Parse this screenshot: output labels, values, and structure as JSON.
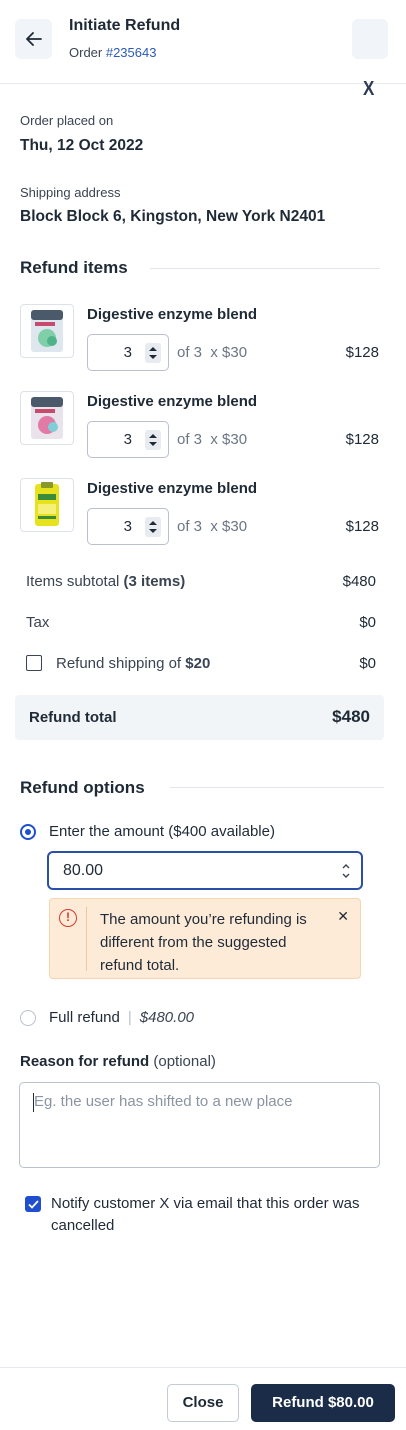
{
  "header": {
    "title": "Initiate Refund",
    "order_prefix": "Order ",
    "order_number": "#235643",
    "close_mark": "X"
  },
  "order": {
    "placed_label": "Order placed on",
    "placed_value": "Thu, 12 Oct 2022",
    "address_label": "Shipping address",
    "address_value": "Block Block 6, Kingston, New York N2401"
  },
  "refund_items": {
    "title": "Refund items",
    "items": [
      {
        "name": "Digestive enzyme blend",
        "qty": "3",
        "of_text": "of 3  x $30",
        "price": "$128",
        "thumb_icon": "pack-pink-green-icon"
      },
      {
        "name": "Digestive enzyme blend",
        "qty": "3",
        "of_text": "of 3  x $30",
        "price": "$128",
        "thumb_icon": "pack-pink-icon"
      },
      {
        "name": "Digestive enzyme blend",
        "qty": "3",
        "of_text": "of 3  x $30",
        "price": "$128",
        "thumb_icon": "pack-yellow-icon"
      }
    ]
  },
  "summary": {
    "subtotal_label": "Items subtotal ",
    "subtotal_count": "(3 items)",
    "subtotal_amount": "$480",
    "tax_label": "Tax",
    "tax_amount": "$0",
    "shipping_label": "Refund shipping of ",
    "shipping_value": "$20",
    "shipping_amount": "$0",
    "shipping_checked": false,
    "total_label": "Refund total",
    "total_amount": "$480"
  },
  "refund_options": {
    "title": "Refund options",
    "enter_amount_label": "Enter the amount ($400 available)",
    "amount_value": "80.00",
    "warning": "The amount you’re refunding is different from the suggested refund total.",
    "full_refund_label": "Full refund",
    "full_refund_separator": "|",
    "full_refund_amount": "$480.00",
    "selected": "enter_amount"
  },
  "reason": {
    "label": "Reason for refund",
    "optional": "(optional)",
    "placeholder": "Eg. the user has shifted to a new place"
  },
  "notify": {
    "checked": true,
    "text": "Notify customer X via email that this order was cancelled"
  },
  "footer": {
    "close_label": "Close",
    "refund_label": "Refund $80.00"
  },
  "colors": {
    "accent": "#1f4fcf",
    "primary_button": "#1a2c47",
    "warning_bg": "#fdebd8",
    "warning_icon": "#d6392f",
    "total_bg": "#f2f5f8"
  }
}
